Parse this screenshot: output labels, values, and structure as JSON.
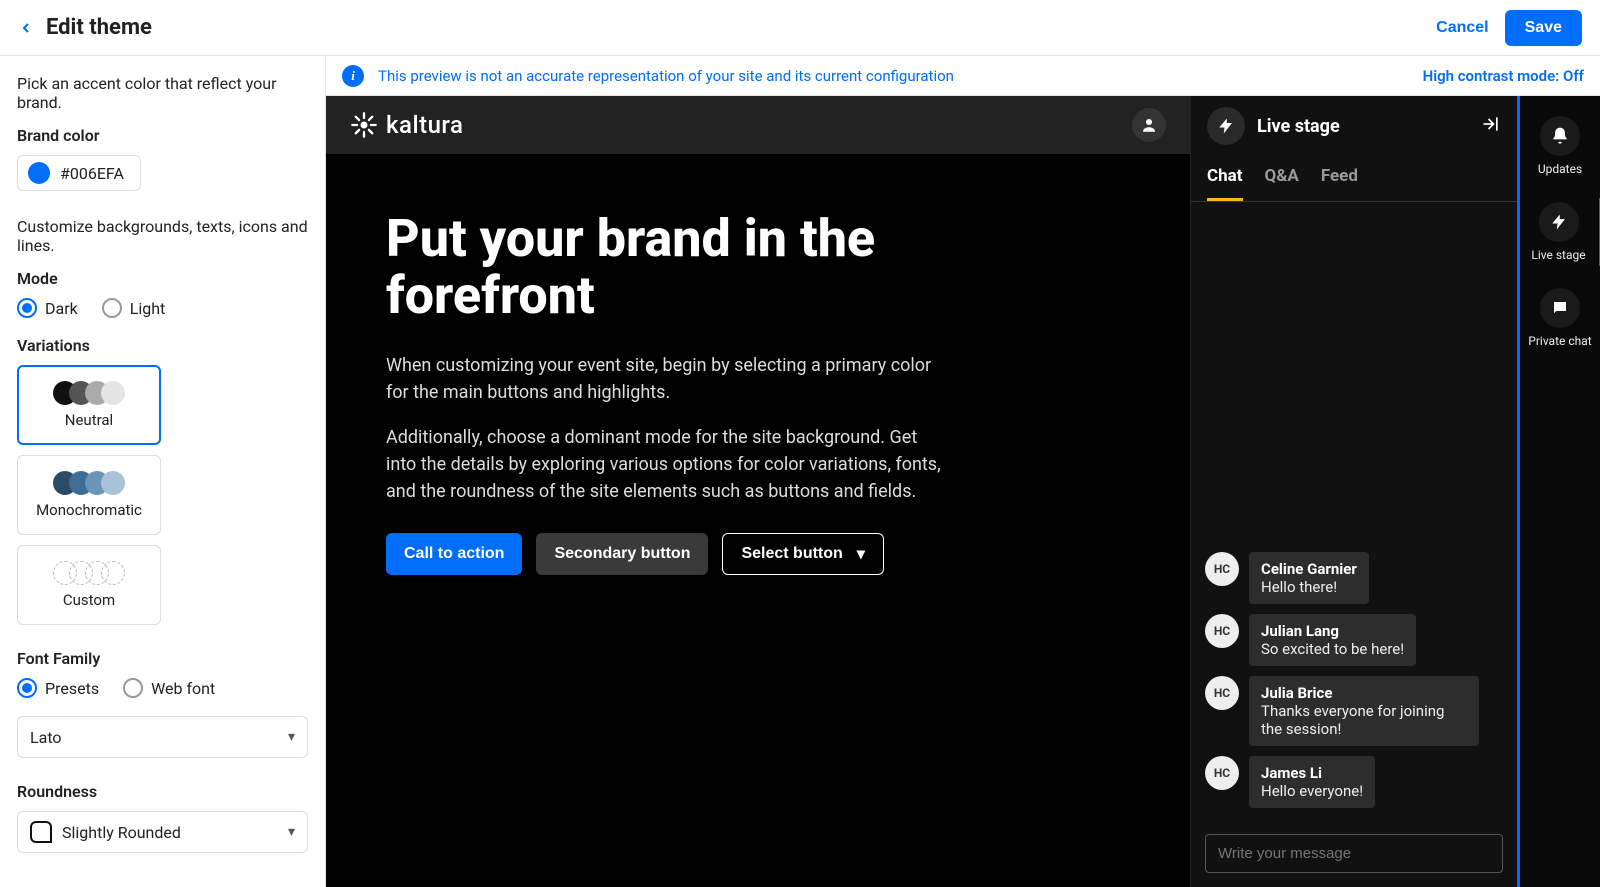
{
  "colors": {
    "accent": "#006EFA"
  },
  "header": {
    "title": "Edit theme",
    "cancel": "Cancel",
    "save": "Save"
  },
  "sidebar": {
    "accent_desc": "Pick an accent color that reflect your brand.",
    "brand_color_label": "Brand color",
    "brand_color_value": "#006EFA",
    "customize_desc": "Customize backgrounds, texts, icons and lines.",
    "mode_label": "Mode",
    "mode_options": {
      "dark": "Dark",
      "light": "Light"
    },
    "mode_selected": "dark",
    "variations_label": "Variations",
    "variations": [
      {
        "key": "neutral",
        "label": "Neutral"
      },
      {
        "key": "monochromatic",
        "label": "Monochromatic"
      },
      {
        "key": "custom",
        "label": "Custom"
      }
    ],
    "variations_selected": "neutral",
    "font_family_label": "Font Family",
    "font_options": {
      "presets": "Presets",
      "web": "Web font"
    },
    "font_source_selected": "presets",
    "font_select_value": "Lato",
    "roundness_label": "Roundness",
    "roundness_value": "Slightly Rounded"
  },
  "notice": {
    "text": "This preview is not an accurate representation of your site and its current configuration",
    "contrast": "High contrast mode: Off"
  },
  "preview": {
    "brand": "kaltura",
    "headline": "Put your brand in the forefront",
    "para1": "When customizing your event site, begin by selecting a primary color for the main buttons and highlights.",
    "para2": "Additionally, choose a dominant mode for the site background. Get into the details by exploring various options for color variations, fonts, and the roundness of the site elements such as buttons and fields.",
    "cta": "Call to action",
    "secondary": "Secondary button",
    "select": "Select button"
  },
  "chat": {
    "title": "Live stage",
    "tabs": [
      {
        "key": "chat",
        "label": "Chat"
      },
      {
        "key": "qa",
        "label": "Q&A"
      },
      {
        "key": "feed",
        "label": "Feed"
      }
    ],
    "active_tab": "chat",
    "messages": [
      {
        "initials": "HC",
        "name": "Celine Garnier",
        "text": "Hello there!"
      },
      {
        "initials": "HC",
        "name": "Julian Lang",
        "text": "So excited to be here!"
      },
      {
        "initials": "HC",
        "name": "Julia Brice",
        "text": "Thanks everyone for joining the session!"
      },
      {
        "initials": "HC",
        "name": "James Li",
        "text": "Hello everyone!"
      }
    ],
    "input_placeholder": "Write your message"
  },
  "rail": {
    "items": [
      {
        "key": "updates",
        "label": "Updates",
        "icon": "bell"
      },
      {
        "key": "livestage",
        "label": "Live stage",
        "icon": "bolt"
      },
      {
        "key": "privatechat",
        "label": "Private chat",
        "icon": "chat"
      }
    ],
    "active": "livestage"
  }
}
